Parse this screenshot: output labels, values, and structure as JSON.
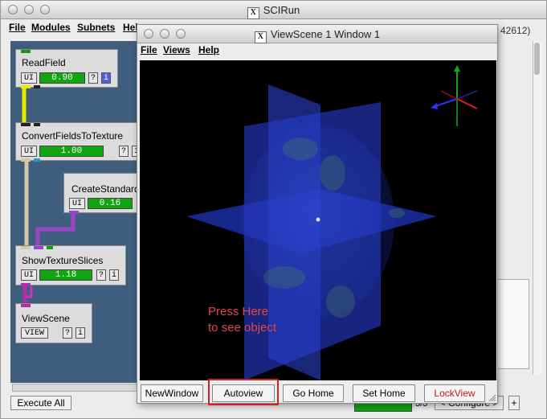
{
  "main_window": {
    "title": "SCIRun",
    "menu": [
      "File",
      "Modules",
      "Subnets",
      "Help"
    ],
    "status_right": "42612)",
    "execute_all": "Execute All",
    "bottom_status": "3/3",
    "configure": "< Configure >",
    "plus": "+"
  },
  "modules": [
    {
      "name": "ReadField",
      "ui": "UI",
      "progress": "0.90",
      "help": "?",
      "info": "i"
    },
    {
      "name": "ConvertFieldsToTexture",
      "ui": "UI",
      "progress": "1.00",
      "help": "?",
      "info": "i"
    },
    {
      "name": "CreateStandard",
      "ui": "UI",
      "progress": "0.16"
    },
    {
      "name": "ShowTextureSlices",
      "ui": "UI",
      "progress": "1.18",
      "help": "?",
      "info": "i"
    },
    {
      "name": "ViewScene",
      "ui": "VIEW",
      "help": "?",
      "info": "i"
    }
  ],
  "viewscene": {
    "title": "ViewScene 1 Window 1",
    "menu": [
      "File",
      "Views",
      "Help"
    ],
    "buttons": {
      "new_window": "NewWindow",
      "autoview": "Autoview",
      "go_home": "Go Home",
      "set_home": "Set Home",
      "lock_view": "LockView"
    },
    "annotation_line1": "Press Here",
    "annotation_line2": "to see object"
  },
  "colors": {
    "canvas": "#3f5e7e",
    "progress": "#11a611",
    "highlight": "#d02020",
    "lockview": "#c0181a"
  }
}
